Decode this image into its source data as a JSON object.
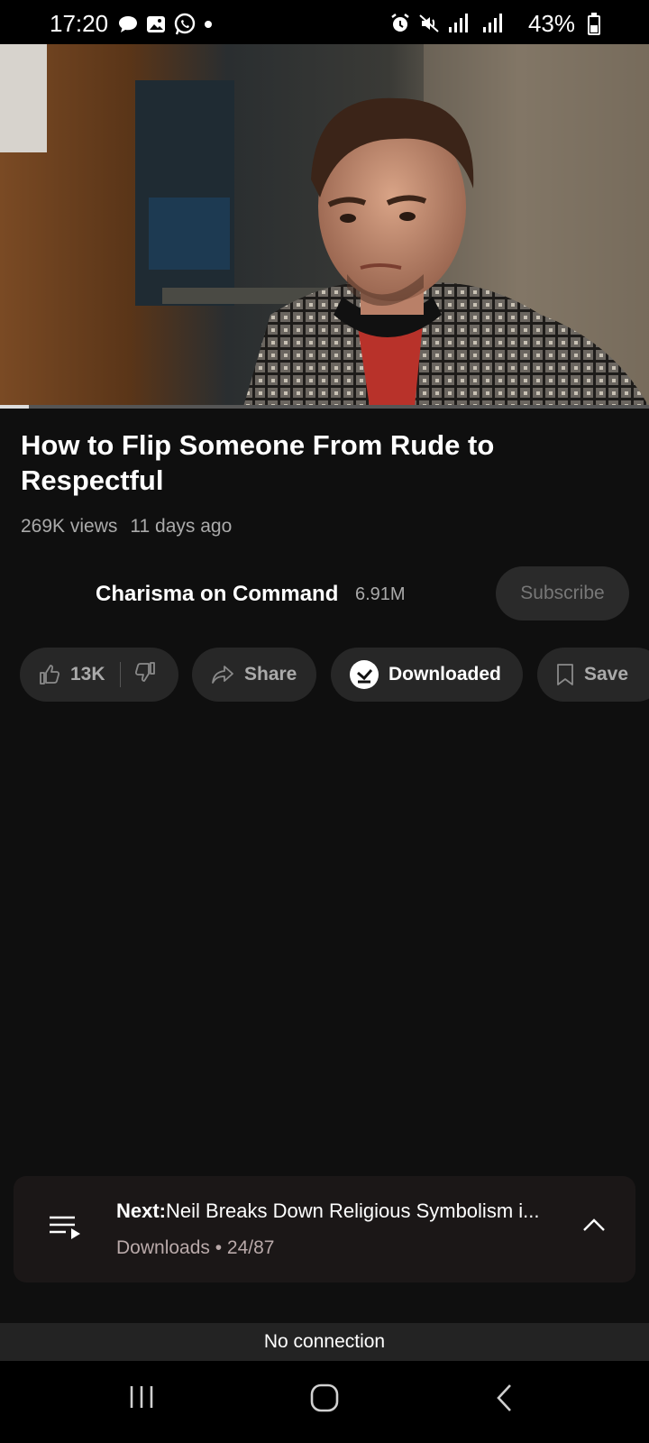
{
  "status_bar": {
    "time": "17:20",
    "battery": "43%",
    "battery_level": 0.43,
    "left_icons": [
      "chat-bubble-icon",
      "gallery-icon",
      "whatsapp-icon",
      "dot-icon"
    ],
    "right_icons": [
      "alarm-icon",
      "mute-icon",
      "signal-icon",
      "signal-icon"
    ]
  },
  "player": {
    "progress": 0.045,
    "colors": {
      "track": "#555555",
      "fill": "#dddddd"
    }
  },
  "video": {
    "title": "How to Flip Someone From Rude to Respectful",
    "views": "269K views",
    "age": "11 days ago"
  },
  "channel": {
    "name": "Charisma on Command",
    "subscribers": "6.91M",
    "subscribe_label": "Subscribe"
  },
  "actions": {
    "likes": "13K",
    "share_label": "Share",
    "downloaded_label": "Downloaded",
    "save_label": "Save"
  },
  "next": {
    "label": "Next:",
    "title": "Neil Breaks Down Religious Symbolism i...",
    "source": "Downloads • 24/87"
  },
  "banner": {
    "text": "No connection"
  },
  "nav": [
    "recents-icon",
    "home-icon",
    "back-icon"
  ]
}
